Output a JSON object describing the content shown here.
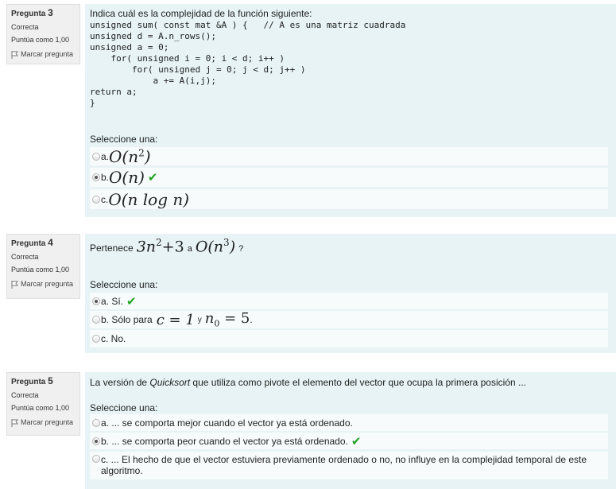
{
  "questions": [
    {
      "label": "Pregunta",
      "number": "3",
      "state": "Correcta",
      "grade": "Puntúa como 1,00",
      "flag": "Marcar pregunta",
      "text": "Indica cuál es la complejidad de la función siguiente:",
      "code": "unsigned sum( const mat &A ) {   // A es una matriz cuadrada\nunsigned d = A.n_rows();\nunsigned a = 0;\n    for( unsigned i = 0; i < d; i++ )\n        for( unsigned j = 0; j < d; j++ )\n            a += A(i,j);\nreturn a;\n}",
      "prompt": "Seleccione una:",
      "options": [
        {
          "letter": "a.",
          "math_main": "O(n",
          "math_sup": "2",
          "math_close": ")"
        },
        {
          "letter": "b.",
          "math_main": "O(n)"
        },
        {
          "letter": "c.",
          "math_main": "O(n log n)"
        }
      ]
    },
    {
      "label": "Pregunta",
      "number": "4",
      "state": "Correcta",
      "grade": "Puntúa como 1,00",
      "flag": "Marcar pregunta",
      "text_before": "Pertenece",
      "text_math1": "3n",
      "text_math1_sup": "2",
      "text_math1_tail": "+3",
      "text_mid": "a",
      "text_math2": "O(n",
      "text_math2_sup": "3",
      "text_math2_tail": ")",
      "text_after": "?",
      "prompt": "Seleccione una:",
      "options": [
        {
          "text": "a. Sí."
        },
        {
          "text": "b. Sólo para",
          "math1": "c = 1",
          "mid": "y",
          "math2": "n",
          "math2_sub": "0",
          "math2_tail": " = 5",
          "end": "."
        },
        {
          "text": "c. No."
        }
      ]
    },
    {
      "label": "Pregunta",
      "number": "5",
      "state": "Correcta",
      "grade": "Puntúa como 1,00",
      "flag": "Marcar pregunta",
      "text_before": "La versión de",
      "text_italic": "Quicksort",
      "text_after": "que utiliza como pivote el elemento del vector que ocupa la primera posición ...",
      "prompt": "Seleccione una:",
      "options": [
        {
          "text": "a. ... se comporta mejor cuando el vector ya está ordenado."
        },
        {
          "text": "b. ... se comporta peor cuando el vector ya está ordenado."
        },
        {
          "text": "c. ... El hecho de que el vector estuviera previamente ordenado o no, no influye en la complejidad temporal de este algoritmo."
        }
      ]
    }
  ],
  "check_mark": "✔"
}
